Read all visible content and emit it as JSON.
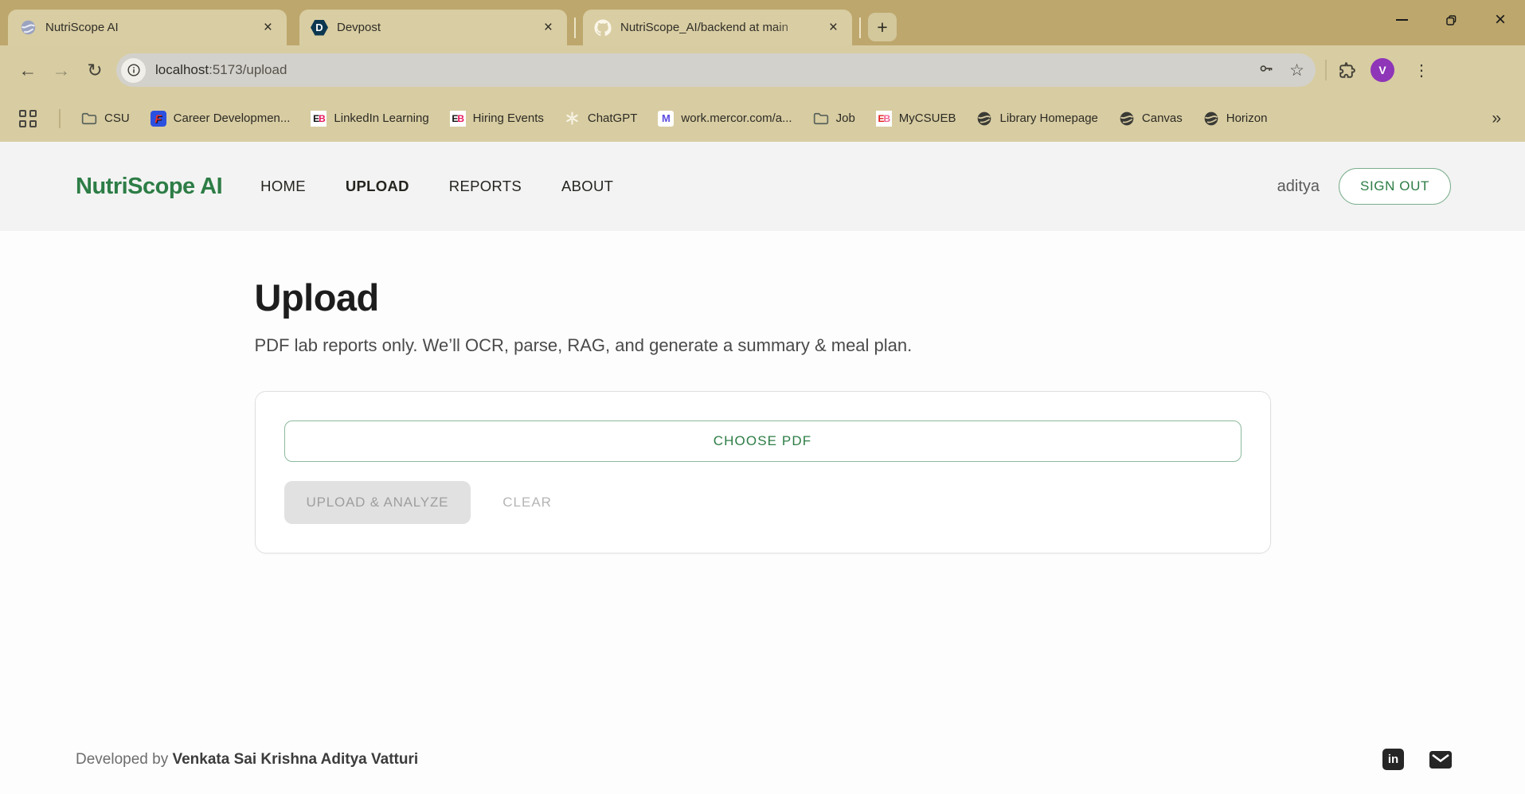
{
  "window_controls": {
    "minimize": "minimize",
    "restore": "restore",
    "close": "×"
  },
  "tabs": {
    "items": [
      {
        "title": "NutriScope AI",
        "favicon": "globe-favicon",
        "close": "×"
      },
      {
        "title": "Devpost",
        "favicon": "devpost-favicon",
        "close": "×"
      },
      {
        "title": "NutriScope_AI/backend at main",
        "favicon": "github-favicon",
        "close": "×"
      }
    ],
    "new_tab": "+"
  },
  "toolbar": {
    "back": "←",
    "forward": "→",
    "reload": "↻",
    "url_host": "localhost",
    "url_path": ":5173/upload",
    "bookmark_star": "☆",
    "avatar_initial": "V",
    "menu_dots": "⋮"
  },
  "bookmarks": {
    "items": [
      {
        "label": "CSU",
        "icon": "folder"
      },
      {
        "label": "Career Developmen...",
        "icon": "career"
      },
      {
        "label": "LinkedIn Learning",
        "icon": "eb"
      },
      {
        "label": "Hiring Events",
        "icon": "eb"
      },
      {
        "label": "ChatGPT",
        "icon": "chatgpt"
      },
      {
        "label": "work.mercor.com/a...",
        "icon": "mercor"
      },
      {
        "label": "Job",
        "icon": "folder"
      },
      {
        "label": "MyCSUEB",
        "icon": "eb-pink"
      },
      {
        "label": "Library Homepage",
        "icon": "globe"
      },
      {
        "label": "Canvas",
        "icon": "globe"
      },
      {
        "label": "Horizon",
        "icon": "globe"
      }
    ],
    "icon_letters": {
      "eb_e": "E",
      "eb_b": "B",
      "career": "F",
      "mercor": "M",
      "devpost": "D",
      "linkedin": "in"
    },
    "overflow": "»"
  },
  "site": {
    "header": {
      "logo": "NutriScope AI",
      "nav": [
        {
          "label": "HOME"
        },
        {
          "label": "UPLOAD"
        },
        {
          "label": "REPORTS"
        },
        {
          "label": "ABOUT"
        }
      ],
      "active_nav": "UPLOAD",
      "user": "aditya",
      "signout": "SIGN OUT"
    },
    "main": {
      "title": "Upload",
      "description": "PDF lab reports only. We’ll OCR, parse, RAG, and generate a summary & meal plan.",
      "choose_button": "CHOOSE PDF",
      "upload_button": "UPLOAD & ANALYZE",
      "clear_button": "CLEAR"
    },
    "footer": {
      "prefix": "Developed by ",
      "name": "Venkata Sai Krishna Aditya Vatturi"
    }
  },
  "colors": {
    "frame_tan": "#bda76c",
    "strip_tan": "#d8cca2",
    "brand_green": "#2d7d46",
    "avatar_purple": "#8e35b8"
  }
}
